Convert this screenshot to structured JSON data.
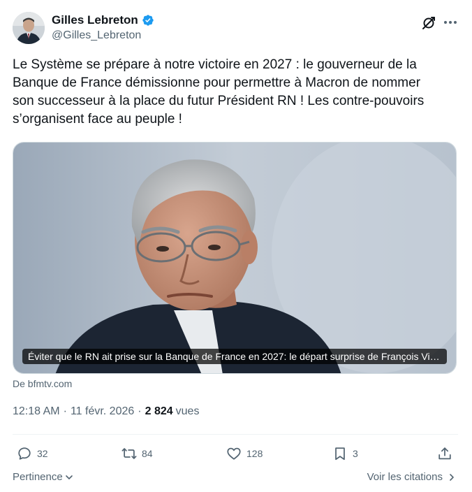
{
  "author": {
    "display_name": "Gilles Lebreton",
    "handle": "@Gilles_Lebreton",
    "verified": true
  },
  "tweet": {
    "text": "Le Système se prépare à notre victoire en 2027 : le gouverneur de la\nBanque de France démissionne pour permettre à Macron de nommer\nson successeur à la place du futur Président RN ! Les contre-pouvoirs\ns’organisent face au peuple !"
  },
  "card": {
    "caption": "Éviter que le RN ait prise sur la Banque de France en 2027: le départ surprise de François Villeroy de Galhau",
    "source": "De bfmtv.com"
  },
  "meta": {
    "time": "12:18 AM",
    "separator": "·",
    "date": "11 févr. 2026",
    "views_count": "2 824",
    "views_label": "vues"
  },
  "actions": {
    "replies": "32",
    "reposts": "84",
    "likes": "128",
    "bookmarks": "3"
  },
  "footer": {
    "sort_label": "Pertinence",
    "quotes_label": "Voir les citations"
  },
  "icons": {
    "verified": "verified-badge-icon",
    "grok": "grok-icon",
    "more": "more-icon",
    "reply": "reply-icon",
    "repost": "repost-icon",
    "like": "heart-icon",
    "bookmark": "bookmark-icon",
    "share": "share-icon"
  },
  "colors": {
    "verified_blue": "#1d9bf0",
    "secondary_text": "#536471",
    "primary_text": "#0f1419"
  }
}
